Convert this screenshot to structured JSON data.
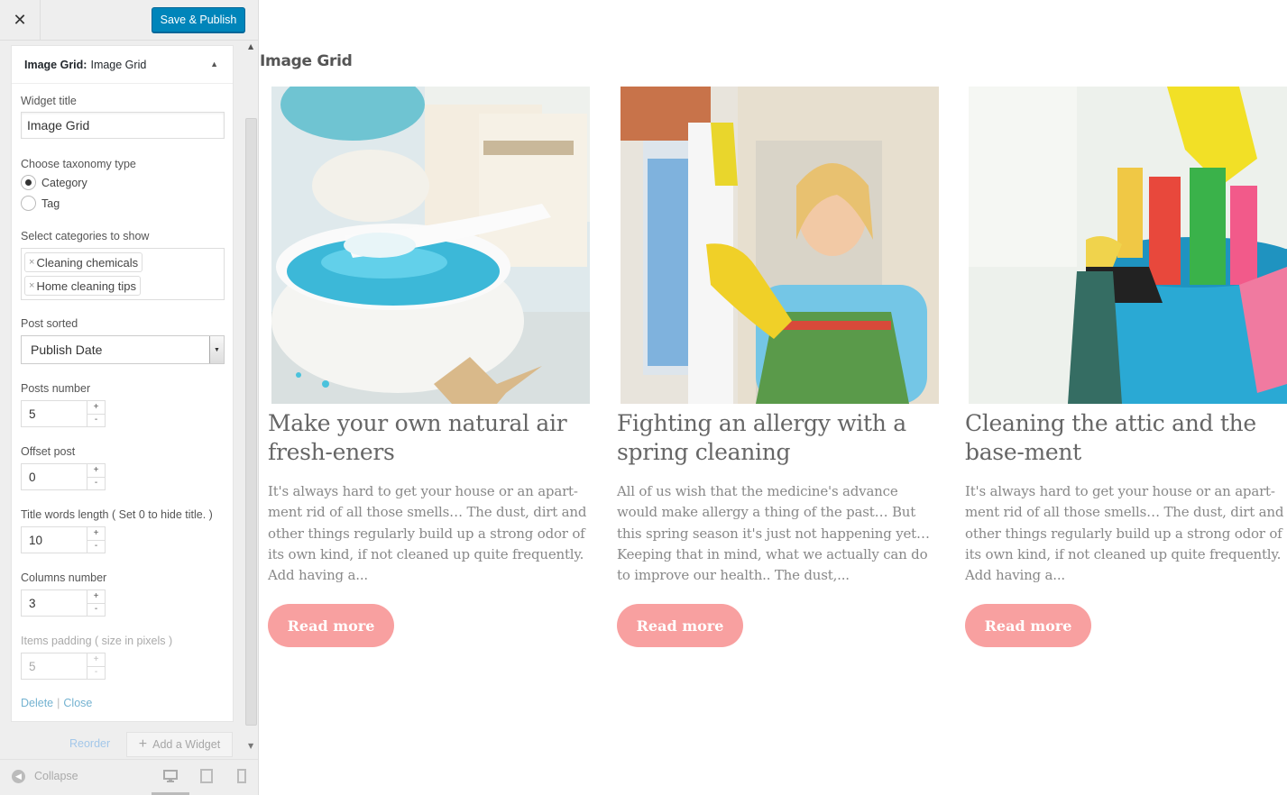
{
  "toolbar": {
    "close_glyph": "✕",
    "publish_label": "Save & Publish"
  },
  "widget": {
    "header_bold": "Image Grid:",
    "header_rest": "Image Grid",
    "title_label": "Widget title",
    "title_value": "Image Grid",
    "taxonomy_label": "Choose taxonomy type",
    "taxonomy_options": [
      "Category",
      "Tag"
    ],
    "taxonomy_selected": "Category",
    "categories_label": "Select categories to show",
    "categories": [
      "Cleaning chemicals",
      "Home cleaning tips"
    ],
    "chip_remove_glyph": "×",
    "sorted_label": "Post sorted",
    "sorted_value": "Publish Date",
    "posts_number_label": "Posts number",
    "posts_number_value": "5",
    "offset_label": "Offset post",
    "offset_value": "0",
    "title_words_label": "Title words length ( Set 0 to hide title. )",
    "title_words_value": "10",
    "columns_label": "Columns number",
    "columns_value": "3",
    "padding_label": "Items padding ( size in pixels )",
    "padding_value": "5",
    "stepper_plus": "+",
    "stepper_minus": "-",
    "delete_link": "Delete",
    "close_link": "Close"
  },
  "footer": {
    "reorder_label": "Reorder",
    "add_widget_label": "Add a Widget",
    "collapse_label": "Collapse",
    "devices": [
      "desktop-icon",
      "tablet-icon",
      "mobile-icon"
    ]
  },
  "preview": {
    "section_title": "Image Grid",
    "read_more": "Read more",
    "posts": [
      {
        "image": "bath-salt-image",
        "title": "Make your own natural air fresh-eners",
        "excerpt": "It's always hard to get your house or an apart-ment rid of all those smells… The dust, dirt and other things regularly build up a strong odor of its own kind, if not cleaned up quite frequently. Add having a..."
      },
      {
        "image": "woman-cleaning-window-image",
        "title": "Fighting an allergy with a spring cleaning",
        "excerpt": "All of us wish that the medicine's advance would make allergy a thing of the past… But this spring season it's just not happening yet… Keeping that in mind, what we actually can do to improve our health.. The dust,..."
      },
      {
        "image": "cleaning-supplies-bucket-image",
        "title": "Cleaning the attic and the base-ment",
        "excerpt": "It's always hard to get your house or an apart-ment rid of all those smells… The dust, dirt and other things regularly build up a strong odor of its own kind, if not cleaned up quite frequently. Add having a..."
      }
    ]
  },
  "colors": {
    "publish": "#0085ba",
    "read_more": "#f8a0a0",
    "link": "#0073aa"
  }
}
